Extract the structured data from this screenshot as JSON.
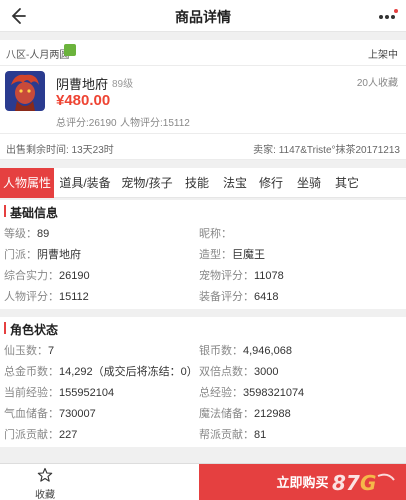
{
  "header": {
    "title": "商品详情",
    "back_icon": "back-arrow-icon",
    "more_icon": "more-dots-icon"
  },
  "server": {
    "name": "八区-人月两圆",
    "platform_icon": "android-icon",
    "status": "上架中"
  },
  "item": {
    "name": "阴曹地府",
    "level": "89级",
    "price": "¥480.00",
    "total_score": "总评分:26190",
    "char_score": "人物评分:15112",
    "favorites": "20人收藏"
  },
  "sale": {
    "time_left": "出售剩余时间: 13天23时",
    "seller": "卖家: 1147&Triste°抹茶20171213"
  },
  "tabs": [
    "人物属性",
    "道具/装备",
    "宠物/孩子",
    "技能",
    "法宝",
    "修行",
    "坐骑",
    "其它"
  ],
  "basic": {
    "title": "基础信息",
    "rows": [
      [
        {
          "k": "等级：",
          "v": "89"
        },
        {
          "k": "昵称：",
          "v": ""
        }
      ],
      [
        {
          "k": "门派：",
          "v": "阴曹地府"
        },
        {
          "k": "造型：",
          "v": "巨魔王"
        }
      ],
      [
        {
          "k": "综合实力：",
          "v": "26190"
        },
        {
          "k": "宠物评分：",
          "v": "11078"
        }
      ],
      [
        {
          "k": "人物评分：",
          "v": "15112"
        },
        {
          "k": "装备评分：",
          "v": "6418"
        }
      ]
    ]
  },
  "role": {
    "title": "角色状态",
    "rows": [
      [
        {
          "k": "仙玉数：",
          "v": "7"
        },
        {
          "k": "银币数：",
          "v": "4,946,068"
        }
      ],
      [
        {
          "k": "总金币数：",
          "v": "14,292（成交后将冻结：0）"
        },
        {
          "k": "双倍点数：",
          "v": "3000"
        }
      ],
      [
        {
          "k": "当前经验：",
          "v": "155952104"
        },
        {
          "k": "总经验：",
          "v": "3598321074"
        }
      ],
      [
        {
          "k": "气血储备：",
          "v": "730007"
        },
        {
          "k": "魔法储备：",
          "v": "212988"
        }
      ],
      [
        {
          "k": "门派贡献：",
          "v": "227"
        },
        {
          "k": "帮派贡献：",
          "v": "81"
        }
      ]
    ]
  },
  "bottom": {
    "fav_label": "收藏",
    "buy_label": "立即购买",
    "fav_icon": "star-icon"
  },
  "watermark": "87G",
  "colors": {
    "accent": "#e54040",
    "price": "#e43"
  }
}
